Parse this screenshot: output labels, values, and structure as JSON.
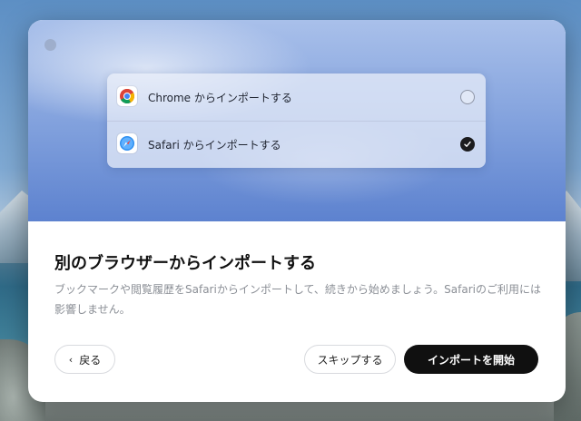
{
  "dialog": {
    "options": [
      {
        "label": "Chrome からインポートする",
        "icon": "chrome-icon",
        "selected": false
      },
      {
        "label": "Safari からインポートする",
        "icon": "safari-icon",
        "selected": true
      }
    ],
    "title": "別のブラウザーからインポートする",
    "subtitle": "ブックマークや閲覧履歴をSafariからインポートして、続きから始めましょう。Safariのご利用には影響しません。",
    "buttons": {
      "back": "戻る",
      "skip": "スキップする",
      "start": "インポートを開始"
    }
  },
  "colors": {
    "primary_button": "#101010",
    "hero_top": "#a9c0ea",
    "hero_bottom": "#5d82cf"
  }
}
